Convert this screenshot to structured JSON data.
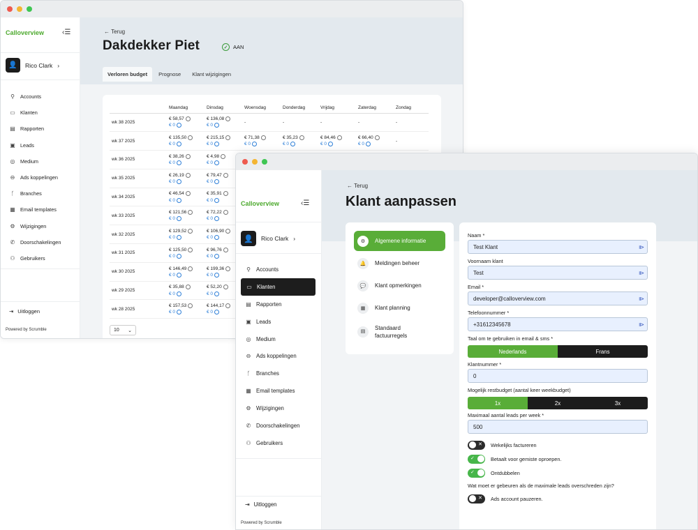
{
  "brand": "Calloverview",
  "user": "Rico Clark",
  "nav": [
    {
      "label": "Accounts",
      "icon": "user-icon"
    },
    {
      "label": "Klanten",
      "icon": "monitor-icon"
    },
    {
      "label": "Rapporten",
      "icon": "document-icon"
    },
    {
      "label": "Leads",
      "icon": "id-card-icon"
    },
    {
      "label": "Medium",
      "icon": "target-icon"
    },
    {
      "label": "Ads koppelingen",
      "icon": "link-icon"
    },
    {
      "label": "Branches",
      "icon": "branch-icon"
    },
    {
      "label": "Email templates",
      "icon": "template-icon"
    },
    {
      "label": "Wijzigingen",
      "icon": "gear-icon"
    },
    {
      "label": "Doorschakelingen",
      "icon": "phone-forward-icon"
    },
    {
      "label": "Gebruikers",
      "icon": "users-icon"
    }
  ],
  "logout": "Uitloggen",
  "powered": "Powered by Scrumble",
  "back": "Terug",
  "win1": {
    "title": "Dakdekker Piet",
    "status": "AAN",
    "tabs": [
      "Verloren budget",
      "Prognose",
      "Klant wijzigingen"
    ],
    "days": [
      "Maandag",
      "Dinsdag",
      "Woensdag",
      "Donderdag",
      "Vrijdag",
      "Zaterdag",
      "Zondag"
    ],
    "rows": [
      {
        "week": "wk 38 2025",
        "cells": [
          "€ 58,57",
          "€ 136,08",
          "-",
          "-",
          "-",
          "-",
          "-"
        ]
      },
      {
        "week": "wk 37 2025",
        "cells": [
          "€ 135,50",
          "€ 215,15",
          "€ 71,38",
          "€ 35,23",
          "€ 84,46",
          "€ 66,40",
          "-"
        ]
      },
      {
        "week": "wk 36 2025",
        "cells": [
          "€ 38,26",
          "€ 4,98",
          "",
          "",
          "",
          "",
          ""
        ]
      },
      {
        "week": "wk 35 2025",
        "cells": [
          "€ 26,19",
          "€ 79,47",
          "",
          "",
          "",
          "",
          ""
        ]
      },
      {
        "week": "wk 34 2025",
        "cells": [
          "€ 46,54",
          "€ 35,91",
          "",
          "",
          "",
          "",
          ""
        ]
      },
      {
        "week": "wk 33 2025",
        "cells": [
          "€ 121,56",
          "€ 72,22",
          "",
          "",
          "",
          "",
          ""
        ]
      },
      {
        "week": "wk 32 2025",
        "cells": [
          "€ 129,52",
          "€ 106,90",
          "",
          "",
          "",
          "",
          ""
        ]
      },
      {
        "week": "wk 31 2025",
        "cells": [
          "€ 125,50",
          "€ 96,76",
          "",
          "",
          "",
          "",
          ""
        ]
      },
      {
        "week": "wk 30 2025",
        "cells": [
          "€ 146,49",
          "€ 199,36",
          "",
          "",
          "",
          "",
          ""
        ]
      },
      {
        "week": "wk 29 2025",
        "cells": [
          "€ 35,88",
          "€ 52,20",
          "",
          "",
          "",
          "",
          ""
        ]
      },
      {
        "week": "wk 28 2025",
        "cells": [
          "€ 157,53",
          "€ 144,17",
          "",
          "",
          "",
          "",
          ""
        ]
      }
    ],
    "sub_value": "€ 0",
    "page_size": "10"
  },
  "win2": {
    "title": "Klant aanpassen",
    "menu": [
      "Algemene informatie",
      "Meldingen beheer",
      "Klant opmerkingen",
      "Klant planning",
      "Standaard factuurregels"
    ],
    "fields": {
      "naam_label": "Naam *",
      "naam": "Test Klant",
      "voornaam_label": "Voornaam klant",
      "voornaam": "Test",
      "email_label": "Email *",
      "email": "developer@calloverview.com",
      "tel_label": "Telefoonnummer *",
      "tel": "+31612345678",
      "taal_label": "Taal om te gebruiken in email & sms *",
      "taal_options": [
        "Nederlands",
        "Frans"
      ],
      "klantnummer_label": "Klantnummer *",
      "klantnummer": "0",
      "restbudget_label": "Mogelijk restbudget (aantal keer weekbudget)",
      "restbudget_options": [
        "1x",
        "2x",
        "3x"
      ],
      "maxleads_label": "Maximaal aantal leads per week *",
      "maxleads": "500",
      "wekelijks": "Wekelijks factureren",
      "gemist": "Betaalt voor gemiste oproepen.",
      "ontdubbelen": "Ontdubbelen",
      "question": "Wat moet er gebeuren als de maximale leads overschreden zijn?",
      "pauzeren": "Ads account pauzeren."
    }
  }
}
